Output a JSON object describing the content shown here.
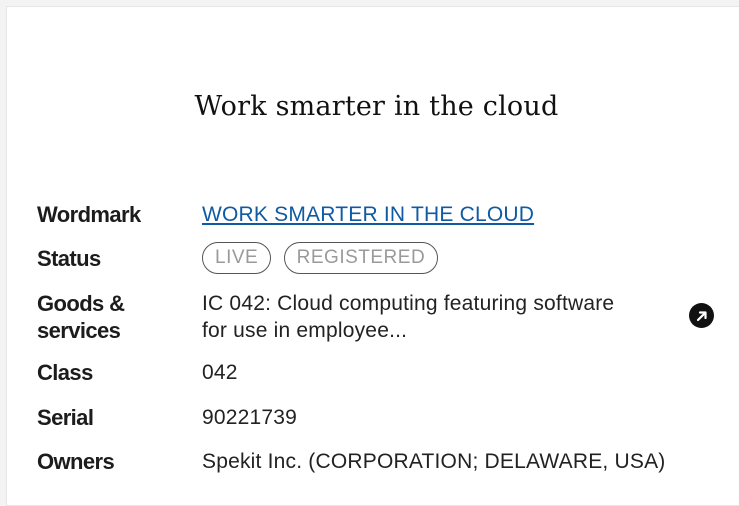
{
  "mark_text": "Work smarter in the cloud",
  "rows": {
    "wordmark": {
      "label": "Wordmark",
      "value": "WORK SMARTER IN THE CLOUD"
    },
    "status": {
      "label": "Status",
      "pills": [
        "LIVE",
        "REGISTERED"
      ]
    },
    "goods": {
      "label_line1": "Goods &",
      "label_line2": "services",
      "value_line1": "IC 042: Cloud computing featuring software",
      "value_line2": "for use in employee..."
    },
    "class": {
      "label": "Class",
      "value": "042"
    },
    "serial": {
      "label": "Serial",
      "value": "90221739"
    },
    "owners": {
      "label": "Owners",
      "value": "Spekit Inc. (CORPORATION; DELAWARE, USA)"
    }
  },
  "icons": {
    "external": "external-link-icon"
  }
}
